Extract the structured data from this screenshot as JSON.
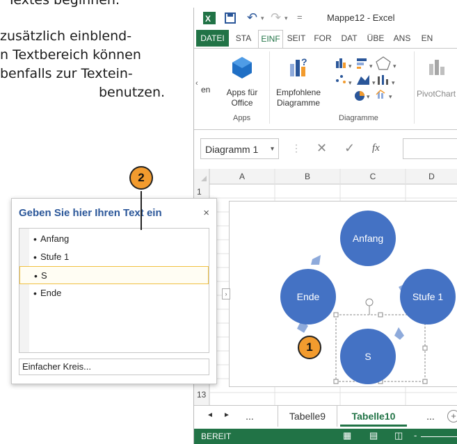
{
  "book_text": {
    "lines": [
      "Textes beginnen.",
      "zusätzlich einblend-",
      "n Textbereich können",
      "benfalls zur Textein-",
      "benutzen."
    ]
  },
  "excel": {
    "window_title": "Mappe12 - Excel",
    "tabs": [
      "DATEI",
      "STA",
      "EINF",
      "SEIT",
      "FOR",
      "DAT",
      "ÜBE",
      "ANS",
      "EN"
    ],
    "active_tab": "EINF",
    "ribbon": {
      "apps_button": "Apps für\nOffice",
      "recommended_charts": "Empfohlene\nDiagramme",
      "pivotchart": "PivotChart",
      "partial_label": "en",
      "group_apps": "Apps",
      "group_charts": "Diagramme"
    },
    "namebox": "Diagramm 1",
    "fx": "fx",
    "columns": [
      "A",
      "B",
      "C",
      "D"
    ],
    "rows": [
      "1",
      "13"
    ],
    "smartart": {
      "nodes": [
        "Anfang",
        "Stufe 1",
        "S",
        "Ende"
      ],
      "fill": "#4472c4",
      "arrow": "#8eaadb"
    },
    "sheet_tabs": [
      "...",
      "Tabelle9",
      "Tabelle10",
      "..."
    ],
    "active_sheet": "Tabelle10",
    "status": "BEREIT",
    "accent": "#217346"
  },
  "text_pane": {
    "title": "Geben Sie hier Ihren Text ein",
    "close": "×",
    "items": [
      "Anfang",
      "Stufe 1",
      "S",
      "Ende"
    ],
    "selected_index": 2,
    "footer": "Einfacher Kreis..."
  },
  "callouts": [
    "1",
    "2"
  ]
}
